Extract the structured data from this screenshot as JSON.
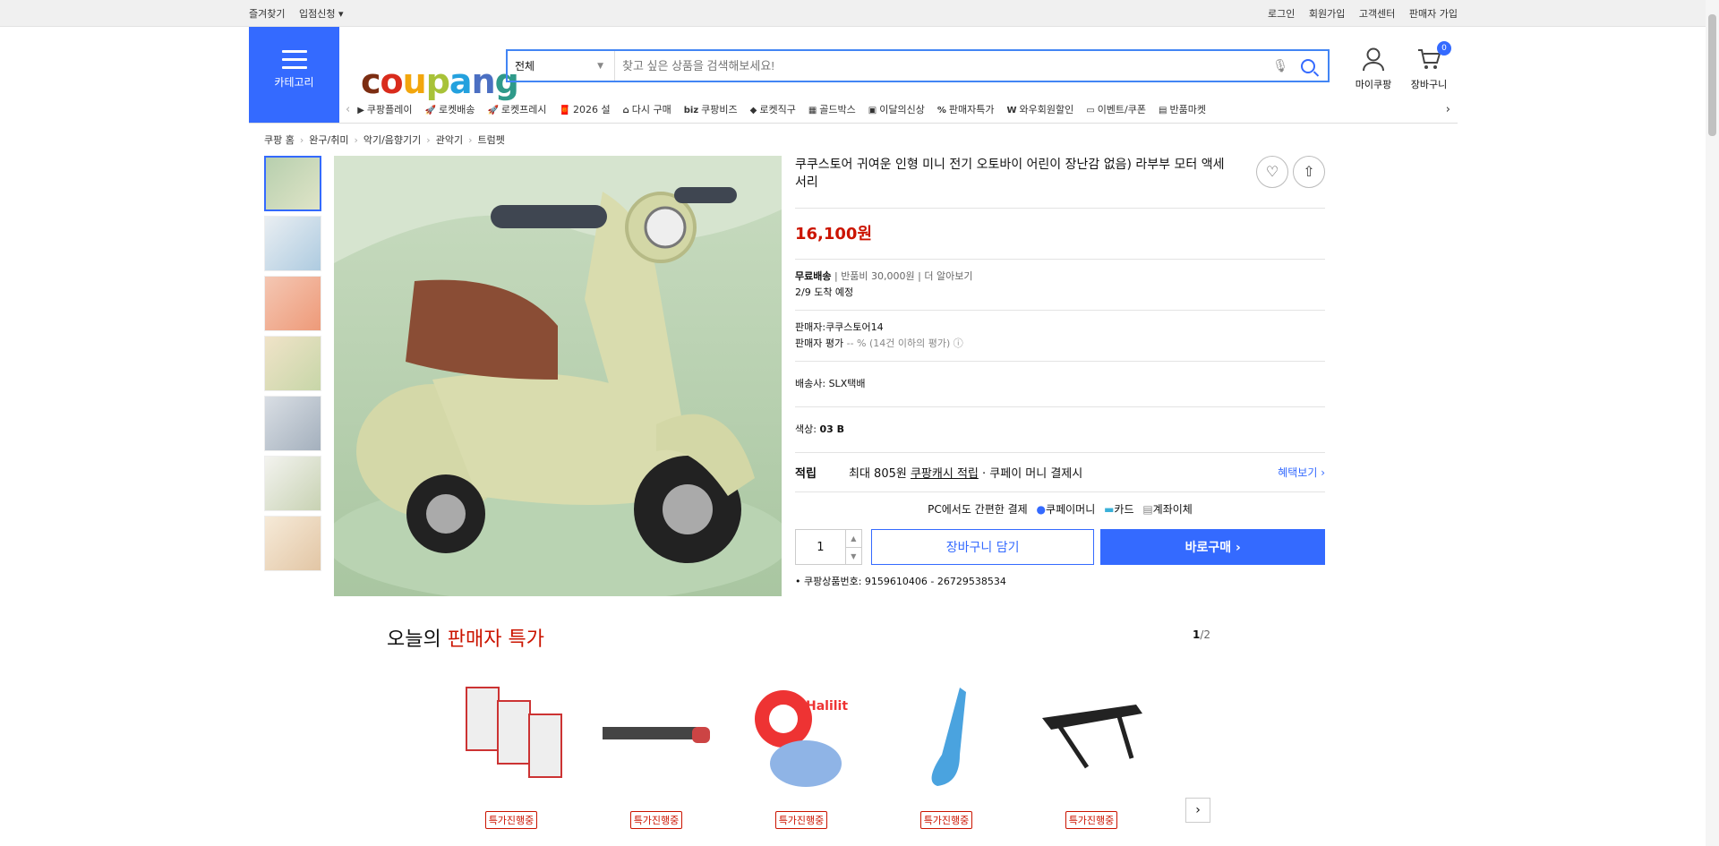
{
  "topbar": {
    "left": [
      "즐겨찾기",
      "입점신청 ▾"
    ],
    "right": [
      "로그인",
      "회원가입",
      "고객센터",
      "판매자 가입"
    ]
  },
  "category_button": {
    "label": "카테고리"
  },
  "logo": {
    "parts": [
      "c",
      "o",
      "u",
      "p",
      "a",
      "n",
      "g"
    ],
    "colors": [
      "#7c2d12",
      "#d92b1c",
      "#f2a60d",
      "#a8c238",
      "#24a1de",
      "#4b6fc2",
      "#2f9a8a"
    ]
  },
  "search": {
    "category": "전체",
    "placeholder": "찾고 싶은 상품을 검색해보세요!"
  },
  "header_icons": {
    "mycoupang": "마이쿠팡",
    "cart": "장바구니",
    "cart_count": "0"
  },
  "catbar": [
    {
      "icon": "▶",
      "label": "쿠팡플레이"
    },
    {
      "icon": "🚀",
      "label": "로켓배송"
    },
    {
      "icon": "🚀",
      "label": "로켓프레시"
    },
    {
      "icon": "🧧",
      "label": "2026 설"
    },
    {
      "icon": "⌂",
      "label": "다시 구매"
    },
    {
      "icon": "biz",
      "label": "쿠팡비즈"
    },
    {
      "icon": "◆",
      "label": "로켓직구"
    },
    {
      "icon": "▦",
      "label": "골드박스"
    },
    {
      "icon": "▣",
      "label": "이달의신상"
    },
    {
      "icon": "%",
      "label": "판매자특가"
    },
    {
      "icon": "W",
      "label": "와우회원할인"
    },
    {
      "icon": "▭",
      "label": "이벤트/쿠폰"
    },
    {
      "icon": "▤",
      "label": "반품마켓"
    }
  ],
  "breadcrumb": [
    "쿠팡 홈",
    "완구/취미",
    "악기/음향기기",
    "관악기",
    "트럼펫"
  ],
  "product": {
    "title": "쿠쿠스토어 귀여운 인형 미니 전기 오토바이 어린이 장난감 없음) 라부부 모터 액세서리",
    "price": "16,100원",
    "shipping": "무료배송",
    "return_fee": "반품비 30,000원",
    "more": "더 알아보기",
    "arrival": "2/9 도착 예정",
    "seller": "판매자:쿠쿠스토어14",
    "seller_rating": "판매자 평가",
    "seller_rating_val": "-- % (14건 이하의 평가)",
    "carrier_label": "배송사:",
    "carrier": "SLX택배",
    "color_label": "색상:",
    "color": "03 B",
    "benefit_title": "적립",
    "benefit_max": "최대 805원",
    "benefit_cash": "쿠팡캐시 적립",
    "benefit_rest": "· 쿠페이 머니 결제시",
    "benefit_link": "혜택보기 ›",
    "pay_title": "PC에서도 간편한 결제",
    "pay_methods": [
      "쿠페이머니",
      "카드",
      "계좌이체"
    ],
    "qty": "1",
    "cart_btn": "장바구니 담기",
    "buy_btn": "바로구매 ›",
    "pid": "쿠팡상품번호: 9159610406 - 26729538534"
  },
  "deals": {
    "title_a": "오늘의",
    "title_b": "판매자 특가",
    "page_cur": "1",
    "page_total": "/2",
    "tag": "특가진행중"
  }
}
